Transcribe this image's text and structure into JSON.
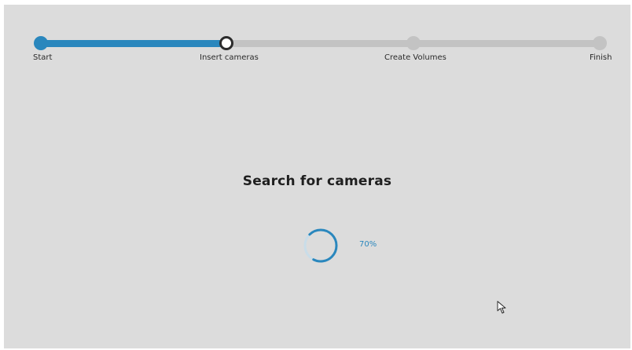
{
  "wizard": {
    "steps": [
      {
        "label": "Start",
        "state": "done"
      },
      {
        "label": "Insert cameras",
        "state": "current"
      },
      {
        "label": "Create Volumes",
        "state": "pending"
      },
      {
        "label": "Finish",
        "state": "pending"
      }
    ]
  },
  "main": {
    "title": "Search for cameras",
    "progress_text": "70%",
    "progress_value": 0.7
  },
  "colors": {
    "accent": "#2a87bd",
    "track": "#c3c3c3",
    "background": "#dcdcdc"
  },
  "icons": {
    "spinner": "loading-spinner-icon",
    "cursor": "mouse-pointer-icon"
  }
}
